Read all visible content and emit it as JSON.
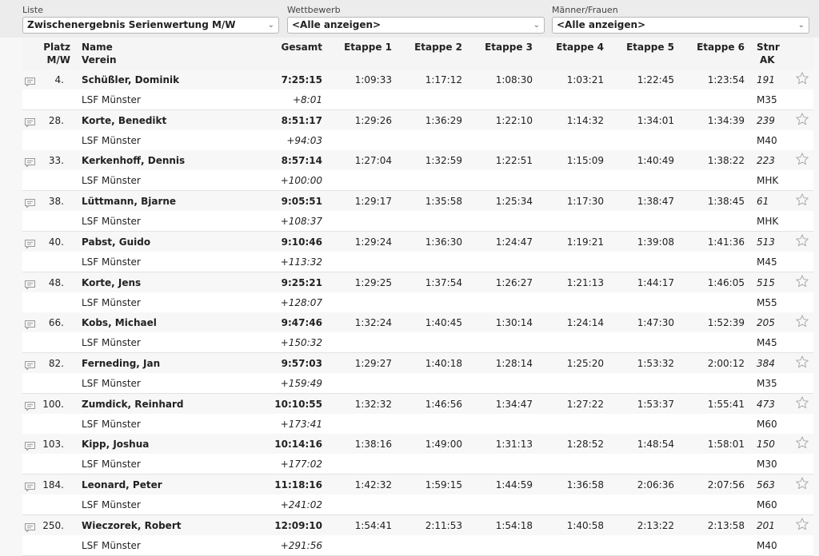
{
  "filters": {
    "liste": {
      "label": "Liste",
      "value": "Zwischenergebnis Serienwertung M/W"
    },
    "wettbewerb": {
      "label": "Wettbewerb",
      "value": "<Alle anzeigen>"
    },
    "geschlecht": {
      "label": "Männer/Frauen",
      "value": "<Alle anzeigen>"
    }
  },
  "columns": {
    "platz": "Platz",
    "platz_sub": "M/W",
    "name": "Name",
    "verein": "Verein",
    "gesamt": "Gesamt",
    "etappe1": "Etappe 1",
    "etappe2": "Etappe 2",
    "etappe3": "Etappe 3",
    "etappe4": "Etappe 4",
    "etappe5": "Etappe 5",
    "etappe6": "Etappe 6",
    "stnr": "Stnr",
    "ak": "AK"
  },
  "icons": {
    "comment": "comment-icon",
    "favorite": "star-icon"
  },
  "rows": [
    {
      "platz": "4.",
      "name": "Schüßler, Dominik",
      "verein": "LSF Münster",
      "gesamt": "7:25:15",
      "diff": "+8:01",
      "etappen": [
        "1:09:33",
        "1:17:12",
        "1:08:30",
        "1:03:21",
        "1:22:45",
        "1:23:54"
      ],
      "stnr": "191",
      "ak": "M35"
    },
    {
      "platz": "28.",
      "name": "Korte, Benedikt",
      "verein": "LSF Münster",
      "gesamt": "8:51:17",
      "diff": "+94:03",
      "etappen": [
        "1:29:26",
        "1:36:29",
        "1:22:10",
        "1:14:32",
        "1:34:01",
        "1:34:39"
      ],
      "stnr": "239",
      "ak": "M40"
    },
    {
      "platz": "33.",
      "name": "Kerkenhoff, Dennis",
      "verein": "LSF Münster",
      "gesamt": "8:57:14",
      "diff": "+100:00",
      "etappen": [
        "1:27:04",
        "1:32:59",
        "1:22:51",
        "1:15:09",
        "1:40:49",
        "1:38:22"
      ],
      "stnr": "223",
      "ak": "MHK"
    },
    {
      "platz": "38.",
      "name": "Lüttmann, Bjarne",
      "verein": "LSF Münster",
      "gesamt": "9:05:51",
      "diff": "+108:37",
      "etappen": [
        "1:29:17",
        "1:35:58",
        "1:25:34",
        "1:17:30",
        "1:38:47",
        "1:38:45"
      ],
      "stnr": "61",
      "ak": "MHK"
    },
    {
      "platz": "40.",
      "name": "Pabst, Guido",
      "verein": "LSF Münster",
      "gesamt": "9:10:46",
      "diff": "+113:32",
      "etappen": [
        "1:29:24",
        "1:36:30",
        "1:24:47",
        "1:19:21",
        "1:39:08",
        "1:41:36"
      ],
      "stnr": "513",
      "ak": "M45"
    },
    {
      "platz": "48.",
      "name": "Korte, Jens",
      "verein": "LSF Münster",
      "gesamt": "9:25:21",
      "diff": "+128:07",
      "etappen": [
        "1:29:25",
        "1:37:54",
        "1:26:27",
        "1:21:13",
        "1:44:17",
        "1:46:05"
      ],
      "stnr": "515",
      "ak": "M55"
    },
    {
      "platz": "66.",
      "name": "Kobs, Michael",
      "verein": "LSF Münster",
      "gesamt": "9:47:46",
      "diff": "+150:32",
      "etappen": [
        "1:32:24",
        "1:40:45",
        "1:30:14",
        "1:24:14",
        "1:47:30",
        "1:52:39"
      ],
      "stnr": "205",
      "ak": "M45"
    },
    {
      "platz": "82.",
      "name": "Ferneding, Jan",
      "verein": "LSF Münster",
      "gesamt": "9:57:03",
      "diff": "+159:49",
      "etappen": [
        "1:29:27",
        "1:40:18",
        "1:28:14",
        "1:25:20",
        "1:53:32",
        "2:00:12"
      ],
      "stnr": "384",
      "ak": "M35"
    },
    {
      "platz": "100.",
      "name": "Zumdick, Reinhard",
      "verein": "LSF Münster",
      "gesamt": "10:10:55",
      "diff": "+173:41",
      "etappen": [
        "1:32:32",
        "1:46:56",
        "1:34:47",
        "1:27:22",
        "1:53:37",
        "1:55:41"
      ],
      "stnr": "473",
      "ak": "M60"
    },
    {
      "platz": "103.",
      "name": "Kipp, Joshua",
      "verein": "LSF Münster",
      "gesamt": "10:14:16",
      "diff": "+177:02",
      "etappen": [
        "1:38:16",
        "1:49:00",
        "1:31:13",
        "1:28:52",
        "1:48:54",
        "1:58:01"
      ],
      "stnr": "150",
      "ak": "M30"
    },
    {
      "platz": "184.",
      "name": "Leonard, Peter",
      "verein": "LSF Münster",
      "gesamt": "11:18:16",
      "diff": "+241:02",
      "etappen": [
        "1:42:32",
        "1:59:15",
        "1:44:59",
        "1:36:58",
        "2:06:36",
        "2:07:56"
      ],
      "stnr": "563",
      "ak": "M60"
    },
    {
      "platz": "250.",
      "name": "Wieczorek, Robert",
      "verein": "LSF Münster",
      "gesamt": "12:09:10",
      "diff": "+291:56",
      "etappen": [
        "1:54:41",
        "2:11:53",
        "1:54:18",
        "1:40:58",
        "2:13:22",
        "2:13:58"
      ],
      "stnr": "201",
      "ak": "M40"
    }
  ]
}
